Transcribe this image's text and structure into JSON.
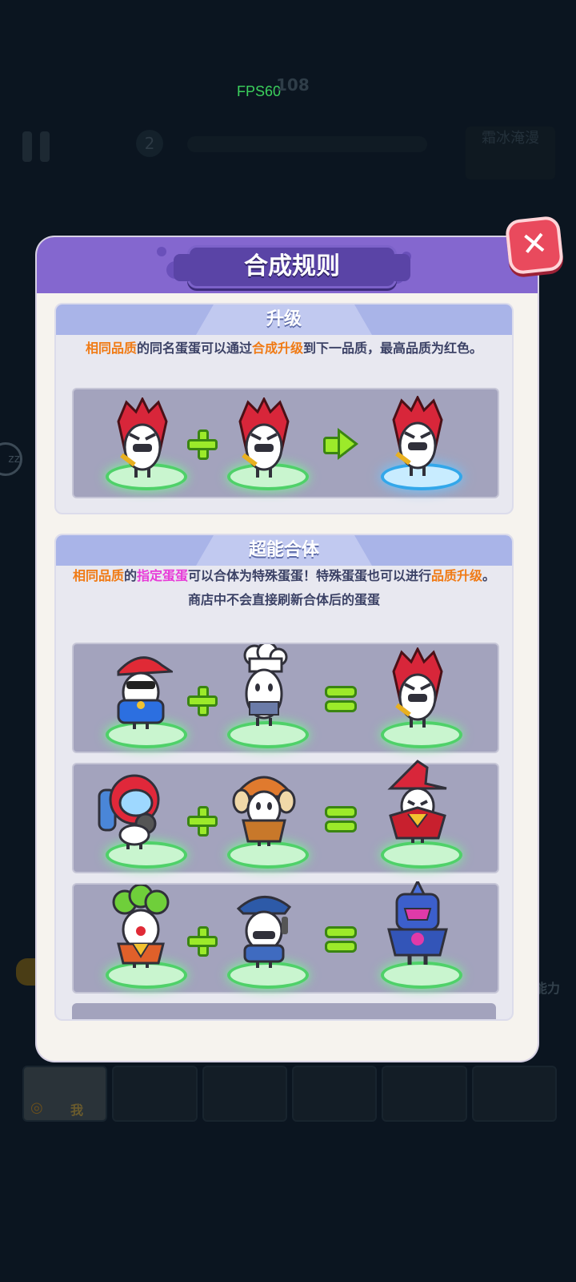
{
  "hud": {
    "fps": "FPS60",
    "coins": "108",
    "level": "2",
    "mode": "霜冰淹漫",
    "slot_label": "我",
    "right_label": "能力",
    "side_badge": "zz"
  },
  "dialog": {
    "title": "合成规则",
    "close_icon": "close-icon"
  },
  "upgrade": {
    "title": "升级",
    "desc_hl1": "相同品质",
    "desc_t1": "的同名蛋蛋可以通过",
    "desc_hl2": "合成升级",
    "desc_t2": "到下一品质，最高品质为红色。",
    "recipe": [
      "red-demon-egg",
      "red-demon-egg",
      "red-demon-egg"
    ]
  },
  "fusion": {
    "title": "超能合体",
    "desc_hl1": "相同品质",
    "desc_t1": "的",
    "desc_hl2": "指定蛋蛋",
    "desc_t2": "可以合体为特殊蛋蛋！特殊蛋蛋也可以进行",
    "desc_hl3": "品质升级",
    "desc_t3": "。",
    "desc_line2": "商店中不会直接刷新合体后的蛋蛋",
    "recipes": [
      [
        "rapper-egg",
        "chef-egg",
        "red-demon-egg"
      ],
      [
        "diver-egg",
        "pilot-egg",
        "wizard-egg"
      ],
      [
        "clown-egg",
        "police-egg",
        "robot-egg"
      ]
    ]
  },
  "colors": {
    "header": "#8467cf",
    "section_header": "#a9b4e8",
    "card": "#a3a3bd",
    "highlight_orange": "#f07a14",
    "highlight_pink": "#e83bd8",
    "plus_green": "#9cea2a",
    "close_red": "#e94a5d"
  }
}
